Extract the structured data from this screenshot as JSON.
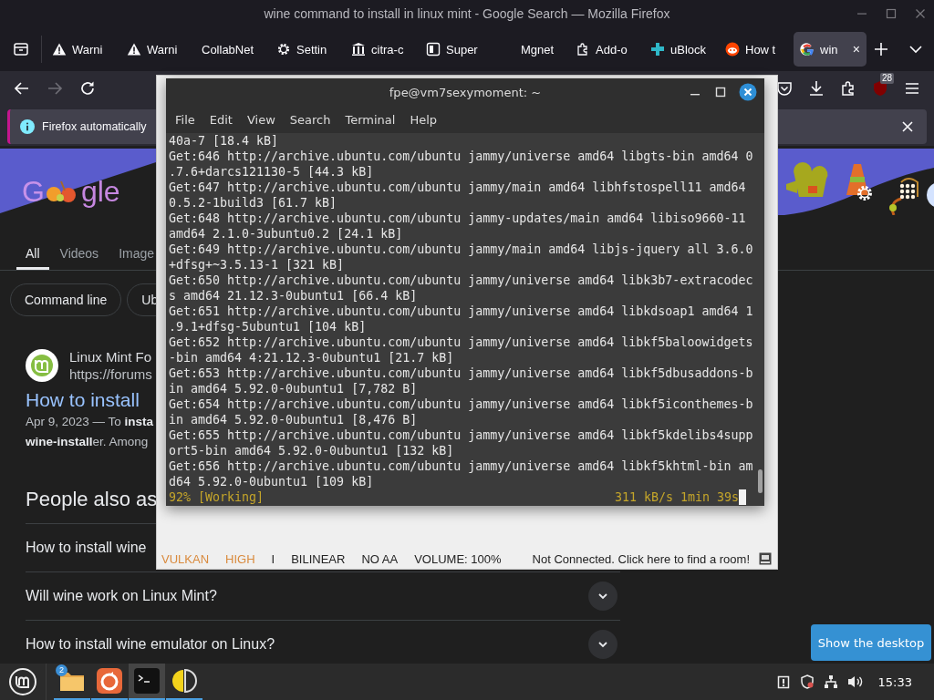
{
  "window": {
    "title": "wine command to install in linux mint - Google Search — Mozilla Firefox"
  },
  "tabs": [
    {
      "label": "Warni",
      "kind": "warning",
      "selected": false
    },
    {
      "label": "Warni",
      "kind": "warning",
      "selected": false
    },
    {
      "label": "CollabNet",
      "kind": "plain",
      "selected": false
    },
    {
      "label": "Settin",
      "kind": "gear",
      "selected": false
    },
    {
      "label": "citra-c",
      "kind": "columns",
      "selected": false
    },
    {
      "label": "Super",
      "kind": "panel",
      "selected": false
    },
    {
      "label": "Mgnet",
      "kind": "blank",
      "selected": false
    },
    {
      "label": "Add-o",
      "kind": "puzzle",
      "selected": false
    },
    {
      "label": "uBlock",
      "kind": "cross",
      "selected": false
    },
    {
      "label": "How t",
      "kind": "robot",
      "selected": false
    },
    {
      "label": "win",
      "kind": "g",
      "selected": true,
      "close": "×"
    }
  ],
  "toolbar": {
    "badge": "28"
  },
  "notification": {
    "text": "Firefox automatically"
  },
  "google": {
    "doodle": {
      "left": "G",
      "right": "gle"
    },
    "tabs": [
      {
        "label": "All",
        "selected": true
      },
      {
        "label": "Videos",
        "selected": false
      },
      {
        "label": "Image",
        "selected": false
      }
    ],
    "chips": [
      "Command line",
      "Ub"
    ],
    "result": {
      "site": "Linux Mint Fo",
      "url": "https://forums",
      "title": "How to install",
      "snippet_1": "Apr 9, 2023 — To **insta**",
      "snippet_2": "**wine-install**er. Among"
    },
    "people_also_ask": {
      "heading": "People also as",
      "questions": [
        {
          "text": "How to install wine",
          "kind": "cut"
        },
        {
          "text": "Will wine work on Linux Mint?",
          "kind": "full"
        },
        {
          "text": "How to install wine emulator on Linux?",
          "kind": "full"
        }
      ]
    }
  },
  "citra": {
    "status": [
      {
        "text": "VULKAN",
        "color": "#d98a3d"
      },
      {
        "text": "HIGH",
        "color": "#d98a3d"
      },
      {
        "text": "I"
      },
      {
        "text": "BILINEAR"
      },
      {
        "text": "NO AA"
      },
      {
        "text": "VOLUME: 100%"
      }
    ],
    "room": "Not Connected. Click here to find a room!"
  },
  "terminal": {
    "title": "fpe@vm7sexymoment: ~",
    "menu": [
      "File",
      "Edit",
      "View",
      "Search",
      "Terminal",
      "Help"
    ],
    "lines": [
      "40a-7 [18.4 kB]",
      "Get:646 http://archive.ubuntu.com/ubuntu jammy/universe amd64 libgts-bin amd64 0",
      ".7.6+darcs121130-5 [44.3 kB]",
      "Get:647 http://archive.ubuntu.com/ubuntu jammy/main amd64 libhfstospell11 amd64",
      "0.5.2-1build3 [61.7 kB]",
      "Get:648 http://archive.ubuntu.com/ubuntu jammy-updates/main amd64 libiso9660-11",
      "amd64 2.1.0-3ubuntu0.2 [24.1 kB]",
      "Get:649 http://archive.ubuntu.com/ubuntu jammy/main amd64 libjs-jquery all 3.6.0",
      "+dfsg+~3.5.13-1 [321 kB]",
      "Get:650 http://archive.ubuntu.com/ubuntu jammy/universe amd64 libk3b7-extracodec",
      "s amd64 21.12.3-0ubuntu1 [66.4 kB]",
      "Get:651 http://archive.ubuntu.com/ubuntu jammy/universe amd64 libkdsoap1 amd64 1",
      ".9.1+dfsg-5ubuntu1 [104 kB]",
      "Get:652 http://archive.ubuntu.com/ubuntu jammy/universe amd64 libkf5baloowidgets",
      "-bin amd64 4:21.12.3-0ubuntu1 [21.7 kB]",
      "Get:653 http://archive.ubuntu.com/ubuntu jammy/universe amd64 libkf5dbusaddons-b",
      "in amd64 5.92.0-0ubuntu1 [7,782 B]",
      "Get:654 http://archive.ubuntu.com/ubuntu jammy/universe amd64 libkf5iconthemes-b",
      "in amd64 5.92.0-0ubuntu1 [8,476 B]",
      "Get:655 http://archive.ubuntu.com/ubuntu jammy/universe amd64 libkf5kdelibs4supp",
      "ort5-bin amd64 5.92.0-0ubuntu1 [132 kB]",
      "Get:656 http://archive.ubuntu.com/ubuntu jammy/universe amd64 libkf5khtml-bin am",
      "d64 5.92.0-0ubuntu1 [109 kB]"
    ],
    "progress": "92% [Working]",
    "rate": "311 kB/s 1min 39s"
  },
  "tooltip": "Show the desktop",
  "taskbar": {
    "apps": [
      {
        "kind": "files",
        "badge": "2",
        "selected": false
      },
      {
        "kind": "firefox",
        "selected": false
      },
      {
        "kind": "terminal",
        "selected": true
      },
      {
        "kind": "citra",
        "selected": false
      }
    ],
    "clock": "15:33"
  }
}
